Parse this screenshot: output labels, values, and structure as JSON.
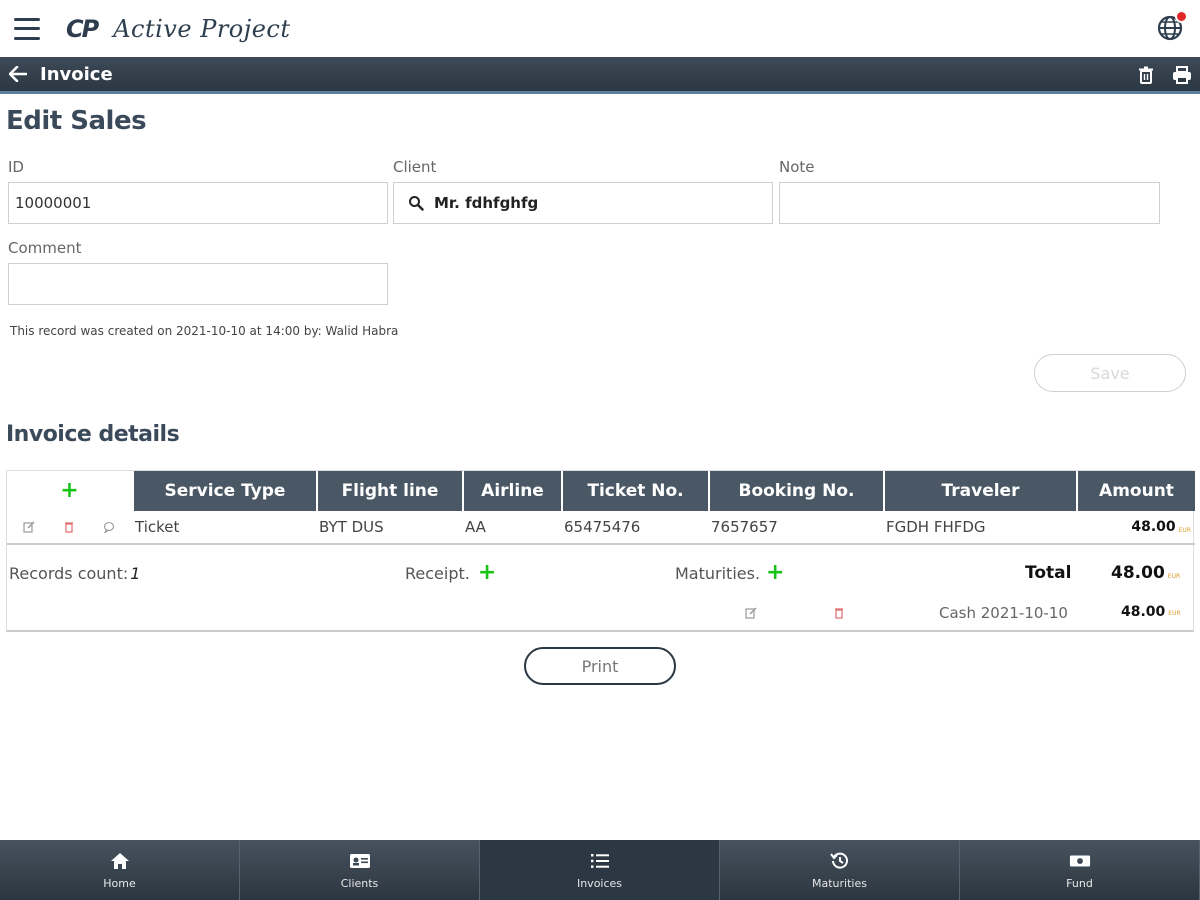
{
  "header": {
    "logo_mark": "CP",
    "app_name": "Active Project"
  },
  "titlebar": {
    "title": "Invoice"
  },
  "form": {
    "heading": "Edit Sales",
    "id_label": "ID",
    "id_value": "10000001",
    "client_label": "Client",
    "client_value": "Mr. fdhfghfg",
    "note_label": "Note",
    "note_value": "",
    "comment_label": "Comment",
    "comment_value": "",
    "created_text": "This record was created on 2021-10-10 at 14:00 by: Walid Habra",
    "save_label": "Save"
  },
  "details": {
    "heading": "Invoice details",
    "add_symbol": "+",
    "columns": [
      "Service Type",
      "Flight line",
      "Airline",
      "Ticket No.",
      "Booking No.",
      "Traveler",
      "Amount"
    ],
    "rows": [
      {
        "service_type": "Ticket",
        "flight_line": "BYT DUS",
        "airline": "AA",
        "ticket_no": "65475476",
        "booking_no": "7657657",
        "traveler": "FGDH FHFDG",
        "amount": "48.00",
        "currency": "EUR"
      }
    ],
    "records_count_label": "Records count:",
    "records_count": "1",
    "receipt_label": "Receipt.",
    "maturities_label": "Maturities.",
    "total_label": "Total",
    "total_value": "48.00",
    "total_currency": "EUR",
    "payment": {
      "label": "Cash 2021-10-10",
      "amount": "48.00",
      "currency": "EUR"
    }
  },
  "print_label": "Print",
  "nav": [
    {
      "label": "Home",
      "icon": "home-icon"
    },
    {
      "label": "Clients",
      "icon": "id-card-icon"
    },
    {
      "label": "Invoices",
      "icon": "list-icon",
      "active": true
    },
    {
      "label": "Maturities",
      "icon": "history-icon"
    },
    {
      "label": "Fund",
      "icon": "money-icon"
    }
  ],
  "colors": {
    "header_bg": "#2b3742",
    "accent_green": "#19c419",
    "danger_red": "#e32626",
    "currency_gold": "#d89c2c"
  }
}
